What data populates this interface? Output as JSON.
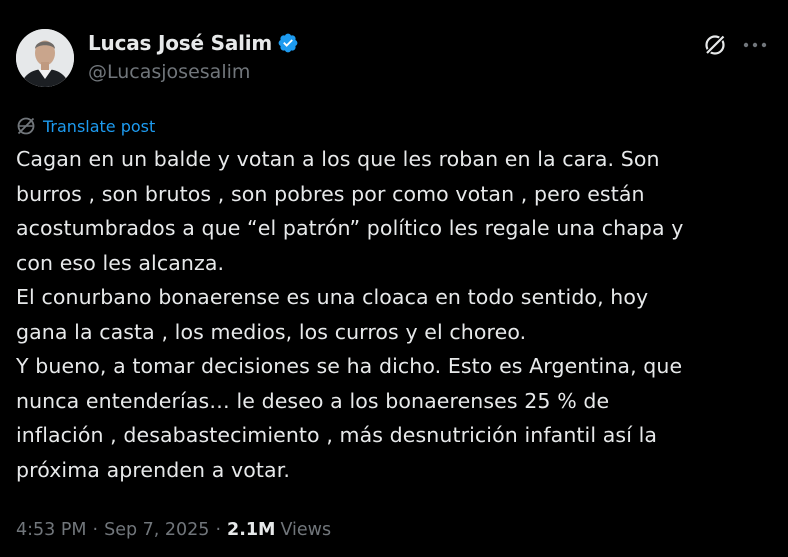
{
  "author": {
    "display_name": "Lucas José Salim",
    "handle": "@Lucasjosesalim",
    "verified": true,
    "verified_color": "#1d9bf0",
    "avatar_icon": "profile-photo"
  },
  "actions": {
    "grok_icon": "grok-icon",
    "more_icon": "more-horizontal-icon"
  },
  "translate": {
    "label": "Translate post",
    "icon": "globe-icon",
    "color": "#1d9bf0"
  },
  "post": {
    "lines": [
      "Cagan en un balde y votan a los que les roban en la cara. Son",
      "burros , son brutos , son pobres por como votan , pero están",
      "acostumbrados a que “el patrón” político les regale una chapa y",
      "con eso les alcanza.",
      "El conurbano bonaerense es una cloaca en todo sentido, hoy",
      "gana la casta , los medios, los curros y el choreo.",
      "Y bueno, a tomar decisiones se ha dicho. Esto es Argentina, que",
      "nunca entenderías… le deseo a los bonaerenses 25 % de",
      "inflación , desabastecimiento , más desnutrición infantil así la",
      "próxima aprenden a votar."
    ]
  },
  "meta": {
    "time": "4:53 PM",
    "separator": "·",
    "date": "Sep 7, 2025",
    "views_count": "2.1M",
    "views_label": "Views"
  },
  "colors": {
    "background": "#000000",
    "text_primary": "#e7e9ea",
    "text_secondary": "#71767b",
    "accent": "#1d9bf0"
  }
}
